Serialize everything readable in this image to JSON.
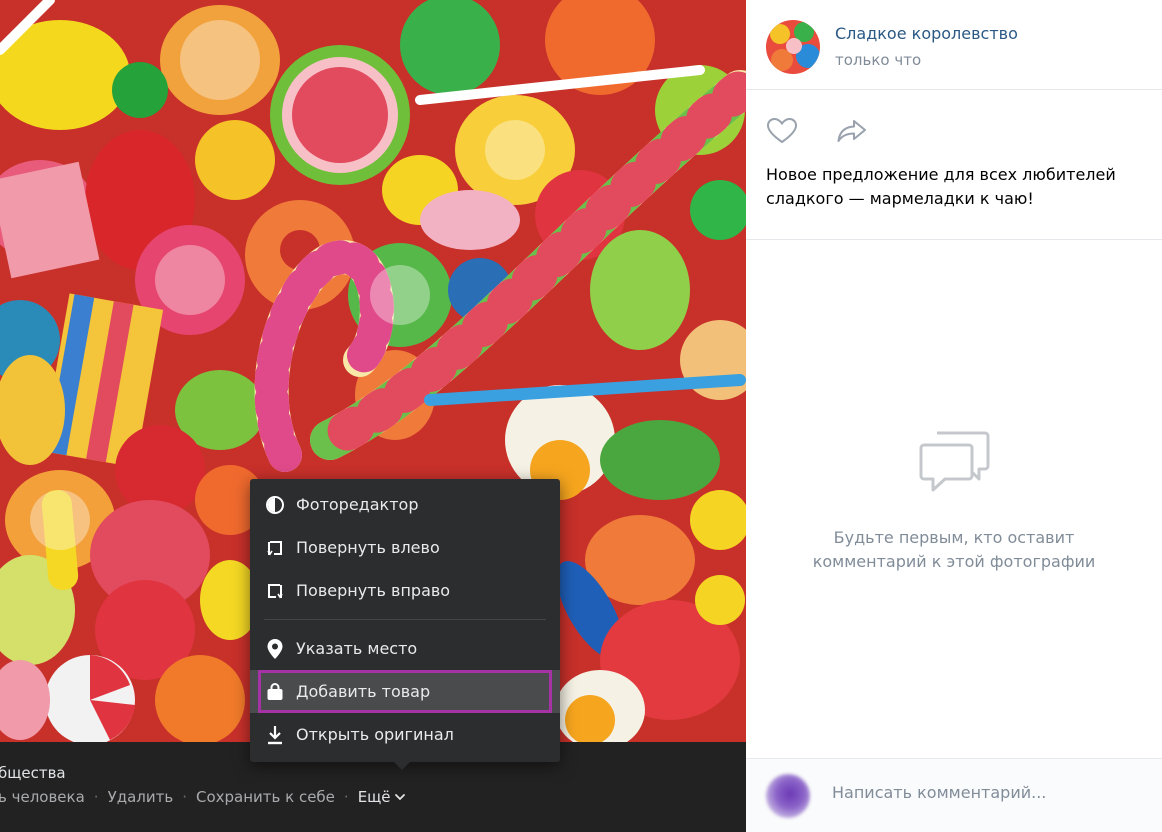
{
  "album": {
    "title_partial": "бщества"
  },
  "actions": {
    "items": [
      "ь человека",
      "Удалить",
      "Сохранить к себе"
    ],
    "more_label": "Ещё"
  },
  "menu": {
    "items": [
      {
        "label": "Фоторедактор",
        "icon": "photo-editor-icon"
      },
      {
        "label": "Повернуть влево",
        "icon": "rotate-left-icon"
      },
      {
        "label": "Повернуть вправо",
        "icon": "rotate-right-icon"
      },
      {
        "label": "Указать место",
        "icon": "location-pin-icon"
      },
      {
        "label": "Добавить товар",
        "icon": "shopping-bag-icon",
        "highlighted": true
      },
      {
        "label": "Открыть оригинал",
        "icon": "download-icon"
      }
    ]
  },
  "post": {
    "group_name": "Сладкое королевство",
    "time": "только что",
    "caption": "Новое предложение для всех любителей сладкого — мармеладки к чаю!"
  },
  "comments": {
    "empty_text": "Будьте первым, кто оставит комментарий к этой фотографии",
    "placeholder": "Написать комментарий..."
  },
  "colors": {
    "highlight_border": "#a633a6",
    "link": "#2a5885",
    "muted": "#818c99"
  }
}
